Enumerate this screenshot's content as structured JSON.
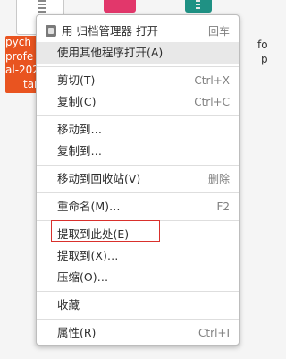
{
  "desktop": {
    "selected_label_lines": [
      "pych",
      "profe",
      "al-202",
      "tar"
    ],
    "right_label_lines": [
      "fo",
      "p"
    ]
  },
  "menu": {
    "items": [
      {
        "label": "用 归档管理器 打开",
        "accel": "回车",
        "icon": "archive-manager-icon"
      },
      {
        "label": "使用其他程序打开(A)",
        "accel": ""
      },
      {
        "label": "剪切(T)",
        "accel": "Ctrl+X"
      },
      {
        "label": "复制(C)",
        "accel": "Ctrl+C"
      },
      {
        "label": "移动到…",
        "accel": ""
      },
      {
        "label": "复制到…",
        "accel": ""
      },
      {
        "label": "移动到回收站(V)",
        "accel": "删除"
      },
      {
        "label": "重命名(M)…",
        "accel": "F2"
      },
      {
        "label": "提取到此处(E)",
        "accel": ""
      },
      {
        "label": "提取到(X)…",
        "accel": ""
      },
      {
        "label": "压缩(O)…",
        "accel": ""
      },
      {
        "label": "收藏",
        "accel": ""
      },
      {
        "label": "属性(R)",
        "accel": "Ctrl+I"
      }
    ]
  },
  "colors": {
    "selection": "#e95420",
    "highlight_box": "#d9302c"
  }
}
